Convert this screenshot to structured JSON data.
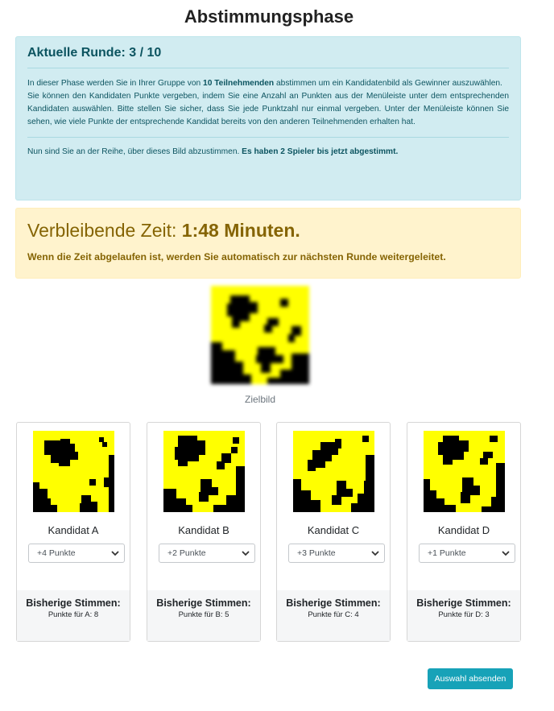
{
  "page": {
    "title": "Abstimmungsphase"
  },
  "info": {
    "round_label": "Aktuelle Runde: 3 / 10",
    "text_1a": "In dieser Phase werden Sie in Ihrer Gruppe von ",
    "text_1b": "10 Teilnehmenden",
    "text_1c": " abstimmen um ein Kandidatenbild als Gewinner auszuwählen.",
    "text_2": "Sie können den Kandidaten Punkte vergeben, indem Sie eine Anzahl an Punkten aus der Menüleiste unter dem entsprechenden Kandidaten auswählen. Bitte stellen Sie sicher, dass Sie jede Punktzahl nur einmal vergeben. Unter der Menüleiste können Sie sehen, wie viele Punkte der entsprechende Kandidat bereits von den anderen Teilnehmenden erhalten hat.",
    "text_3a": "Nun sind Sie an der Reihe, über dieses Bild abzustimmen. ",
    "text_3b": "Es haben 2 Spieler bis jetzt abgestimmt."
  },
  "timer": {
    "prefix": "Verbleibende Zeit: ",
    "value": "1:48 Minuten.",
    "note": "Wenn die Zeit abgelaufen ist, werden Sie automatisch zur nächsten Runde weitergeleitet."
  },
  "target": {
    "caption": "Zielbild"
  },
  "colors": {
    "pattern_yellow": "#ffff00",
    "pattern_black": "#000000",
    "button": "#17a2b8"
  },
  "candidates": [
    {
      "name": "Kandidat A",
      "selected": "+4 Punkte",
      "votes_title": "Bisherige Stimmen:",
      "votes_text": "Punkte für A: 8"
    },
    {
      "name": "Kandidat B",
      "selected": "+2 Punkte",
      "votes_title": "Bisherige Stimmen:",
      "votes_text": "Punkte für B: 5"
    },
    {
      "name": "Kandidat C",
      "selected": "+3 Punkte",
      "votes_title": "Bisherige Stimmen:",
      "votes_text": "Punkte für C: 4"
    },
    {
      "name": "Kandidat D",
      "selected": "+1 Punkte",
      "votes_title": "Bisherige Stimmen:",
      "votes_text": "Punkte für D: 3"
    }
  ],
  "submit": {
    "label": "Auswahl absenden"
  }
}
